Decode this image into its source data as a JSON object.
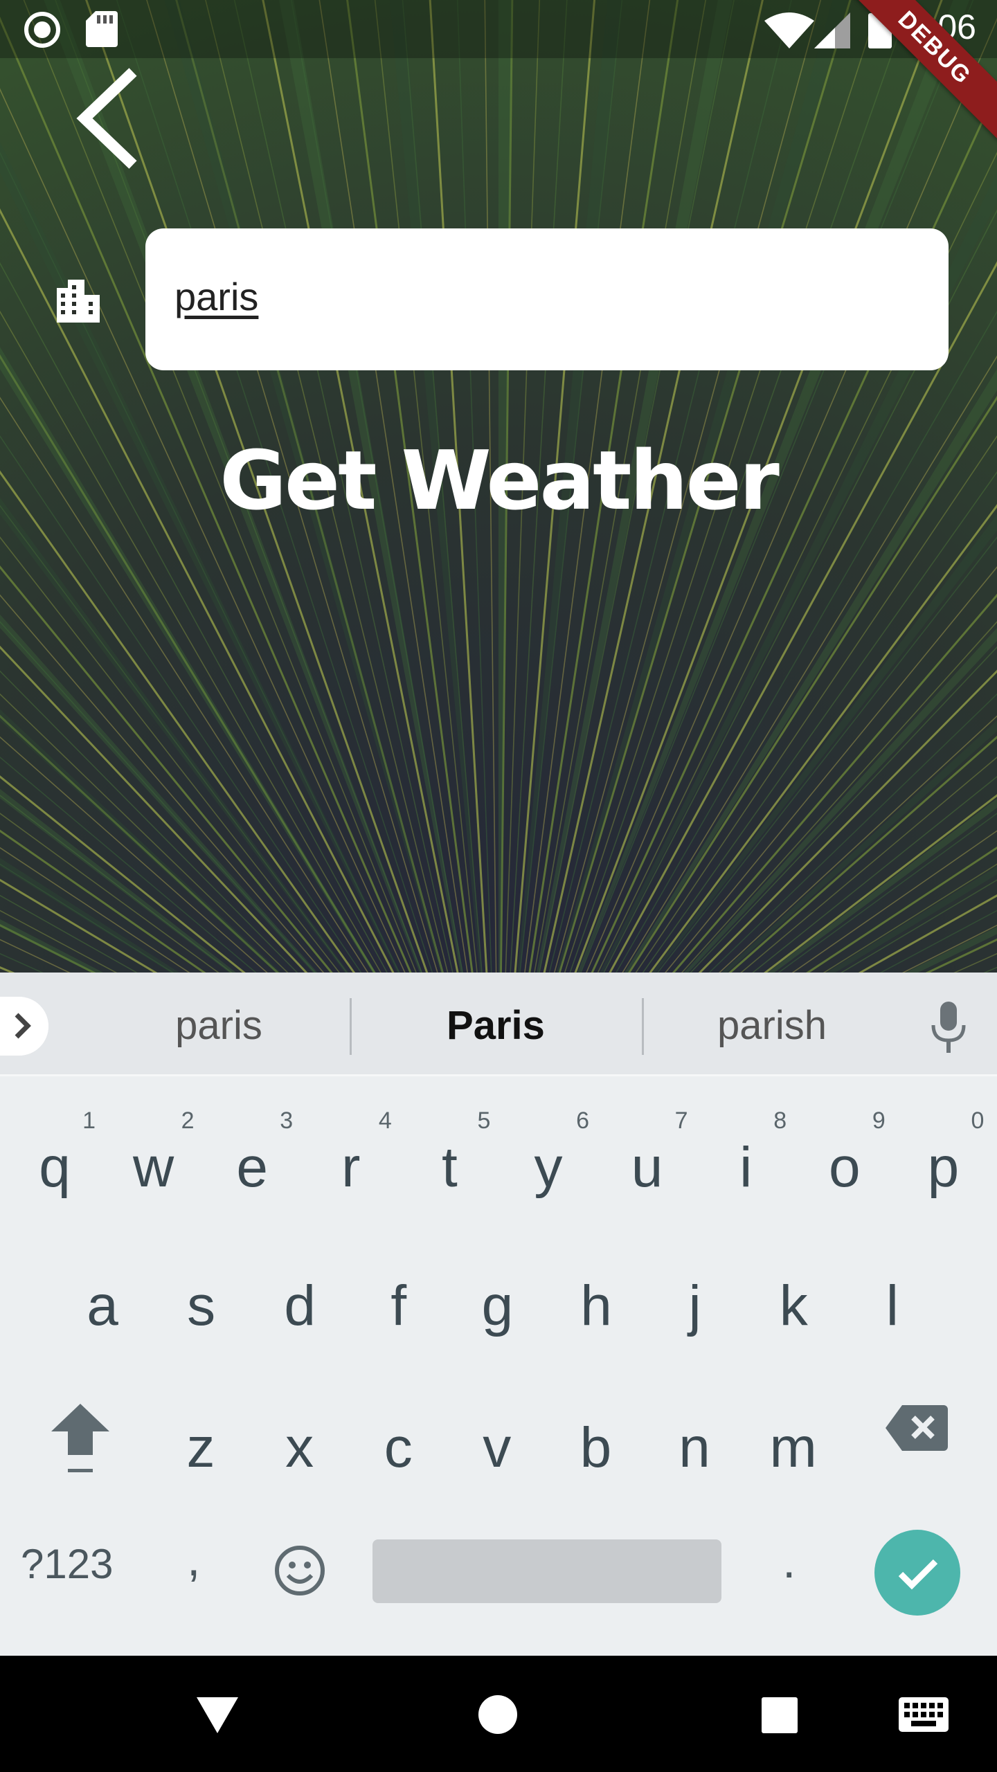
{
  "status_bar": {
    "time": "6:06",
    "icons": [
      "record-icon",
      "sd-card-icon",
      "wifi-icon",
      "signal-icon",
      "battery-icon"
    ]
  },
  "debug_banner": "DEBUG",
  "city_input": {
    "value": "paris",
    "icon": "city-icon"
  },
  "action_label": "Get Weather",
  "keyboard": {
    "suggestions": [
      "paris",
      "Paris",
      "parish"
    ],
    "row1": [
      {
        "letter": "q",
        "num": "1"
      },
      {
        "letter": "w",
        "num": "2"
      },
      {
        "letter": "e",
        "num": "3"
      },
      {
        "letter": "r",
        "num": "4"
      },
      {
        "letter": "t",
        "num": "5"
      },
      {
        "letter": "y",
        "num": "6"
      },
      {
        "letter": "u",
        "num": "7"
      },
      {
        "letter": "i",
        "num": "8"
      },
      {
        "letter": "o",
        "num": "9"
      },
      {
        "letter": "p",
        "num": "0"
      }
    ],
    "row2": [
      "a",
      "s",
      "d",
      "f",
      "g",
      "h",
      "j",
      "k",
      "l"
    ],
    "row3": [
      "z",
      "x",
      "c",
      "v",
      "b",
      "n",
      "m"
    ],
    "symbols_label": "?123",
    "comma_label": ",",
    "period_label": ".",
    "enter_color": "#4db6ac"
  },
  "nav_bar": {
    "icons": [
      "back-triangle-icon",
      "home-circle-icon",
      "recents-square-icon",
      "keyboard-switch-icon"
    ]
  }
}
